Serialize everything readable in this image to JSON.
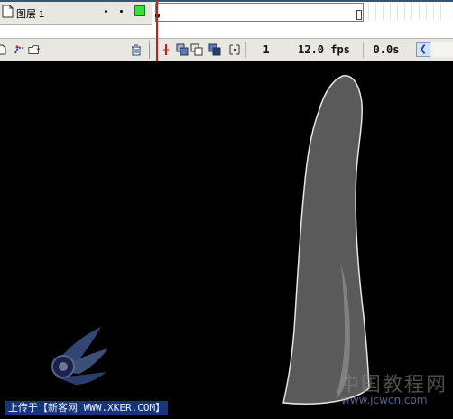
{
  "timeline": {
    "layer_name": "图层 1",
    "current_frame": "1",
    "frame_rate": "12.0 fps",
    "elapsed_time": "0.0s"
  },
  "icons": {
    "layer": "layer-doc-icon",
    "insert_layer": "insert-layer-icon",
    "add_motion_guide": "add-motion-guide-icon",
    "insert_folder": "insert-folder-icon",
    "delete_layer": "trash-icon",
    "center_frame": "center-frame-icon",
    "onion_skin": "onion-skin-icon",
    "onion_outlines": "onion-outlines-icon",
    "edit_multiple": "edit-multiple-frames-icon",
    "modify_markers": "modify-markers-icon",
    "scroll_left": "scroll-left-icon"
  },
  "colors": {
    "stage_bg": "#000000",
    "shape_fill": "#5a5a5a",
    "shape_stroke": "#e6e6e6",
    "layer_color": "#3edc3e",
    "playhead": "#c81d1d"
  },
  "stage": {
    "watermark_text": "中国教程网",
    "watermark_url": "www.jcwcn.com",
    "caption": "上传于【新客网 WWW.XKER.COM】"
  }
}
